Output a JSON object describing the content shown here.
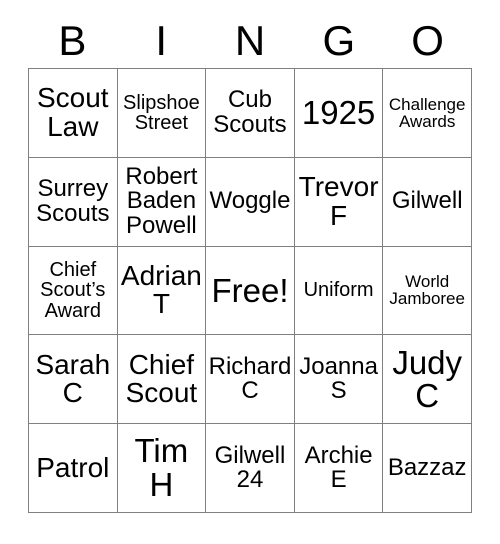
{
  "header": {
    "letters": [
      "B",
      "I",
      "N",
      "G",
      "O"
    ]
  },
  "colors": {
    "background": "#ffffff",
    "text": "#000000",
    "border": "#808080"
  },
  "card": {
    "columns": 5,
    "rows": 5,
    "free_space_label": "Free!",
    "free_space_position": {
      "row": 3,
      "column": 3
    },
    "cells": [
      [
        {
          "text": "Scout\nLaw",
          "size": "lg"
        },
        {
          "text": "Slipshoe\nStreet",
          "size": "sm"
        },
        {
          "text": "Cub\nScouts",
          "size": "md"
        },
        {
          "text": "1925",
          "size": "xl"
        },
        {
          "text": "Challenge\nAwards",
          "size": "xs"
        }
      ],
      [
        {
          "text": "Surrey\nScouts",
          "size": "md"
        },
        {
          "text": "Robert\nBaden\nPowell",
          "size": "md"
        },
        {
          "text": "Woggle",
          "size": "md"
        },
        {
          "text": "Trevor\nF",
          "size": "lg"
        },
        {
          "text": "Gilwell",
          "size": "md"
        }
      ],
      [
        {
          "text": "Chief\nScout’s\nAward",
          "size": "sm"
        },
        {
          "text": "Adrian\nT",
          "size": "lg"
        },
        {
          "text": "Free!",
          "size": "xl"
        },
        {
          "text": "Uniform",
          "size": "sm"
        },
        {
          "text": "World\nJamboree",
          "size": "xs"
        }
      ],
      [
        {
          "text": "Sarah\nC",
          "size": "lg"
        },
        {
          "text": "Chief\nScout",
          "size": "lg"
        },
        {
          "text": "Richard\nC",
          "size": "md"
        },
        {
          "text": "Joanna\nS",
          "size": "md"
        },
        {
          "text": "Judy\nC",
          "size": "xl"
        }
      ],
      [
        {
          "text": "Patrol",
          "size": "lg"
        },
        {
          "text": "Tim\nH",
          "size": "xl"
        },
        {
          "text": "Gilwell\n24",
          "size": "md"
        },
        {
          "text": "Archie\nE",
          "size": "md"
        },
        {
          "text": "Bazzaz",
          "size": "md"
        }
      ]
    ]
  }
}
